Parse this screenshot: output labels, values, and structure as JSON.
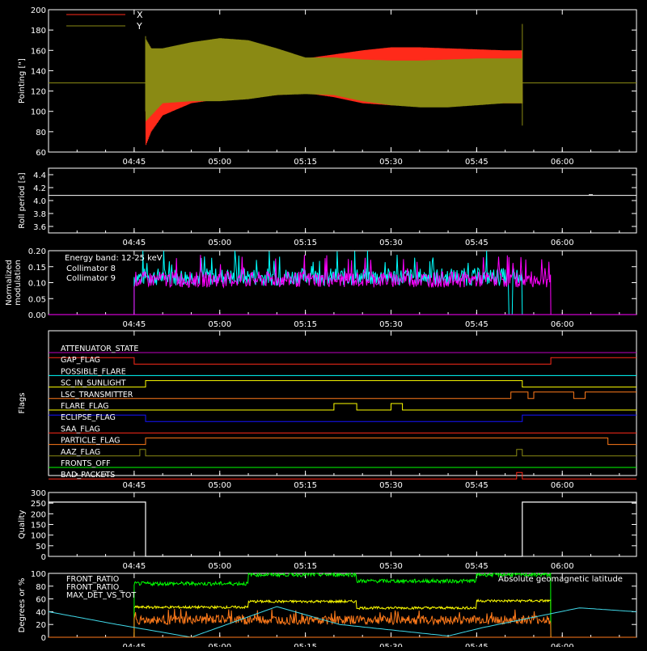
{
  "colors": {
    "background": "#000000",
    "axes": "#ffffff",
    "red": "#ff2a1a",
    "olive": "#8a8a14",
    "cyan": "#00ffff",
    "magenta": "#ff00ff",
    "purple": "#c000c0",
    "blue": "#1414ff",
    "green": "#00ff00",
    "yellow": "#ffff00",
    "orange": "#ff7a1a",
    "lightcyan": "#40d8e8",
    "white": "#ffffff"
  },
  "time_axis": {
    "start": "04:30",
    "end": "06:13",
    "ticks": [
      "04:45",
      "05:00",
      "05:15",
      "05:30",
      "05:45",
      "06:00"
    ]
  },
  "chart_data": [
    {
      "id": "pointing",
      "type": "line",
      "ylabel": "Pointing [\"]",
      "ylim": [
        60,
        200
      ],
      "yticks": [
        60,
        80,
        100,
        120,
        140,
        160,
        180,
        200
      ],
      "legend": {
        "placement": "top-left"
      },
      "series": [
        {
          "name": "X",
          "color": "red",
          "baseline": 128,
          "x": [
            "04:47",
            "04:48",
            "04:50",
            "04:55",
            "05:00",
            "05:05",
            "05:10",
            "05:15",
            "05:20",
            "05:25",
            "05:30",
            "05:35",
            "05:40",
            "05:45",
            "05:50",
            "05:53"
          ],
          "upper": [
            170,
            162,
            158,
            150,
            148,
            145,
            147,
            152,
            156,
            160,
            163,
            163,
            162,
            161,
            160,
            160
          ],
          "lower": [
            66,
            80,
            96,
            108,
            112,
            114,
            116,
            118,
            114,
            108,
            106,
            105,
            106,
            107,
            108,
            108
          ]
        },
        {
          "name": "Y",
          "color": "olive",
          "baseline": 128,
          "x": [
            "04:47",
            "04:48",
            "04:50",
            "04:55",
            "05:00",
            "05:05",
            "05:10",
            "05:15",
            "05:20",
            "05:25",
            "05:30",
            "05:35",
            "05:40",
            "05:45",
            "05:50",
            "05:53"
          ],
          "upper": [
            172,
            162,
            162,
            168,
            172,
            170,
            162,
            153,
            153,
            151,
            150,
            150,
            151,
            152,
            152,
            152
          ],
          "lower": [
            90,
            96,
            108,
            110,
            110,
            112,
            116,
            117,
            116,
            110,
            106,
            104,
            104,
            106,
            108,
            108
          ]
        }
      ]
    },
    {
      "id": "roll_period",
      "type": "line",
      "ylabel": "Roll period [s]",
      "ylim": [
        3.5,
        4.5
      ],
      "yticks": [
        3.6,
        3.8,
        4.0,
        4.2,
        4.4
      ],
      "series": [
        {
          "name": "",
          "color": "white",
          "x": [
            "04:30",
            "06:13"
          ],
          "y": [
            4.08,
            4.08
          ]
        }
      ]
    },
    {
      "id": "modulation",
      "type": "line",
      "ylabel": "Normalized modulation",
      "ylim": [
        0.0,
        0.2
      ],
      "yticks": [
        0.0,
        0.05,
        0.1,
        0.15,
        0.2
      ],
      "legend": {
        "placement": "top-left"
      },
      "annotation": "Energy band: 12-25 keV",
      "series": [
        {
          "name": "Collimator 8",
          "color": "cyan",
          "start": "04:45",
          "end": "05:53",
          "mean": 0.118,
          "spread": 0.028,
          "dropouts": [
            "05:51",
            "05:55"
          ]
        },
        {
          "name": "Collimator 9",
          "color": "magenta",
          "start": "04:45",
          "end": "05:58",
          "mean": 0.11,
          "spread": 0.025,
          "dropouts": []
        }
      ]
    },
    {
      "id": "flags",
      "type": "line",
      "ylabel": "Flags",
      "series": [
        {
          "name": "ATTENUATOR_STATE",
          "color": "purple",
          "levels": []
        },
        {
          "name": "GAP_FLAG",
          "color": "red",
          "levels": [
            [
              "04:30",
              1
            ],
            [
              "04:45",
              0
            ],
            [
              "05:58",
              1
            ]
          ]
        },
        {
          "name": "POSSIBLE_FLARE",
          "color": "cyan",
          "levels": []
        },
        {
          "name": "SC_IN_SUNLIGHT",
          "color": "yellow",
          "levels": [
            [
              "04:30",
              0
            ],
            [
              "04:47",
              1
            ],
            [
              "05:53",
              0
            ]
          ]
        },
        {
          "name": "LSC_TRANSMITTER",
          "color": "orange",
          "levels": [
            [
              "04:30",
              0
            ],
            [
              "05:51",
              1
            ],
            [
              "05:54",
              0
            ],
            [
              "05:55",
              1
            ],
            [
              "06:02",
              0
            ],
            [
              "06:04",
              1
            ]
          ]
        },
        {
          "name": "FLARE_FLAG",
          "color": "yellow",
          "levels": [
            [
              "04:30",
              0
            ],
            [
              "05:20",
              1
            ],
            [
              "05:24",
              0
            ],
            [
              "05:30",
              1
            ],
            [
              "05:32",
              0
            ]
          ]
        },
        {
          "name": "ECLIPSE_FLAG",
          "color": "blue",
          "levels": [
            [
              "04:30",
              1
            ],
            [
              "04:47",
              0
            ],
            [
              "05:53",
              1
            ]
          ]
        },
        {
          "name": "SAA_FLAG",
          "color": "red",
          "levels": []
        },
        {
          "name": "PARTICLE_FLAG",
          "color": "orange",
          "levels": [
            [
              "04:30",
              0
            ],
            [
              "04:47",
              1
            ],
            [
              "05:54",
              1
            ],
            [
              "06:08",
              0
            ]
          ]
        },
        {
          "name": "AAZ_FLAG",
          "color": "olive",
          "levels": [
            [
              "04:30",
              0
            ],
            [
              "04:46",
              1
            ],
            [
              "04:47",
              0
            ],
            [
              "05:52",
              1
            ],
            [
              "05:53",
              0
            ]
          ]
        },
        {
          "name": "FRONTS_OFF",
          "color": "green",
          "levels": []
        },
        {
          "name": "BAD_PACKETS",
          "color": "red",
          "levels": [
            [
              "04:30",
              0
            ],
            [
              "05:52",
              1
            ],
            [
              "05:53",
              0
            ]
          ]
        }
      ]
    },
    {
      "id": "quality",
      "type": "line",
      "ylabel": "Quality",
      "ylim": [
        0,
        300
      ],
      "yticks": [
        0,
        50,
        100,
        150,
        200,
        250,
        300
      ],
      "series": [
        {
          "name": "",
          "color": "white",
          "x": [
            "04:30",
            "04:47",
            "04:47",
            "05:53",
            "05:53",
            "06:13"
          ],
          "y": [
            255,
            255,
            0,
            0,
            255,
            255
          ]
        }
      ]
    },
    {
      "id": "ratios",
      "type": "line",
      "ylabel": "Degrees or %",
      "ylim": [
        0,
        100
      ],
      "yticks": [
        0,
        20,
        40,
        60,
        80,
        100
      ],
      "legend": {
        "placement": "top-left"
      },
      "annotation": "Absolute geomagnetic latitude",
      "series": [
        {
          "name": "FRONT_RATIO",
          "color": "yellow",
          "start": "04:45",
          "end": "05:58",
          "segments": [
            [
              "04:45",
              47
            ],
            [
              "05:05",
              56
            ],
            [
              "05:24",
              46
            ],
            [
              "05:45",
              57
            ],
            [
              "05:58",
              57
            ]
          ],
          "spread": 2
        },
        {
          "name": "FRONT_RATIO_",
          "color": "green",
          "start": "04:45",
          "end": "05:58",
          "segments": [
            [
              "04:45",
              84
            ],
            [
              "05:05",
              98
            ],
            [
              "05:24",
              88
            ],
            [
              "05:45",
              98
            ],
            [
              "05:58",
              98
            ]
          ],
          "spread": 3
        },
        {
          "name": "MAX_DET_VS_TOT",
          "color": "orange",
          "start": "04:45",
          "end": "05:58",
          "mean": 27,
          "spread": 7
        },
        {
          "name": "",
          "color": "lightcyan",
          "x": [
            "04:30",
            "04:42",
            "04:55",
            "05:10",
            "05:21",
            "05:40",
            "05:46",
            "06:03",
            "06:13"
          ],
          "y": [
            40,
            20,
            0,
            48,
            20,
            2,
            15,
            46,
            40
          ]
        }
      ]
    }
  ]
}
